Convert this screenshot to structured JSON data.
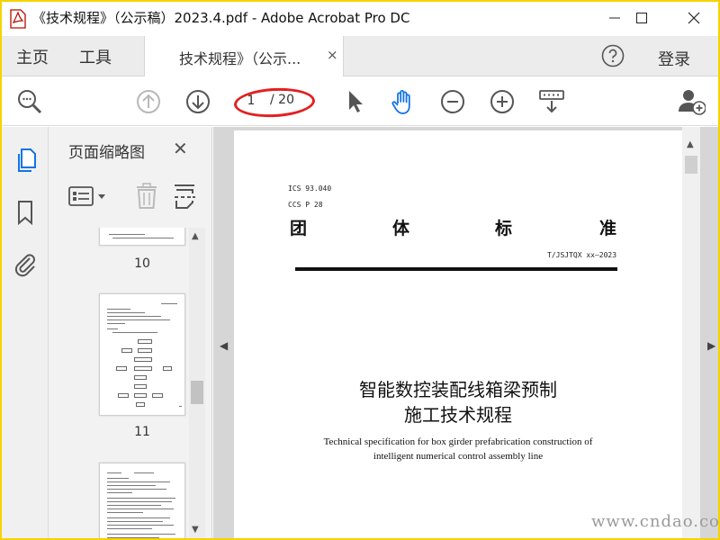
{
  "window": {
    "title": "《技术规程》（公示稿）2023.4.pdf - Adobe Acrobat Pro DC"
  },
  "tabbar": {
    "home_label": "主页",
    "tools_label": "工具",
    "doc_tab_label": "技术规程》（公示...",
    "doc_tab_close": "×",
    "login_label": "登录"
  },
  "toolbar": {
    "current_page": "1",
    "total_pages": "/ 20"
  },
  "thumbnail_panel": {
    "title": "页面缩略图",
    "close": "✕",
    "thumbnails": [
      {
        "number": "10"
      },
      {
        "number": "11"
      },
      {
        "number": ""
      }
    ]
  },
  "document": {
    "ics": "ICS 93.040",
    "ccs": "CCS P 28",
    "standard_chars": [
      "团",
      "体",
      "标",
      "准"
    ],
    "standard_code": "T/JSJTQX  xx—2023",
    "title_zh_line1": "智能数控装配线箱梁预制",
    "title_zh_line2": "施工技术规程",
    "title_en_line1": "Technical specification for box girder prefabrication construction of",
    "title_en_line2": "intelligent numerical control assembly line"
  },
  "watermark": "www.cndao.com",
  "colors": {
    "frame": "#f5d400",
    "annotation": "#e22020",
    "accent_blue": "#1473e6"
  }
}
